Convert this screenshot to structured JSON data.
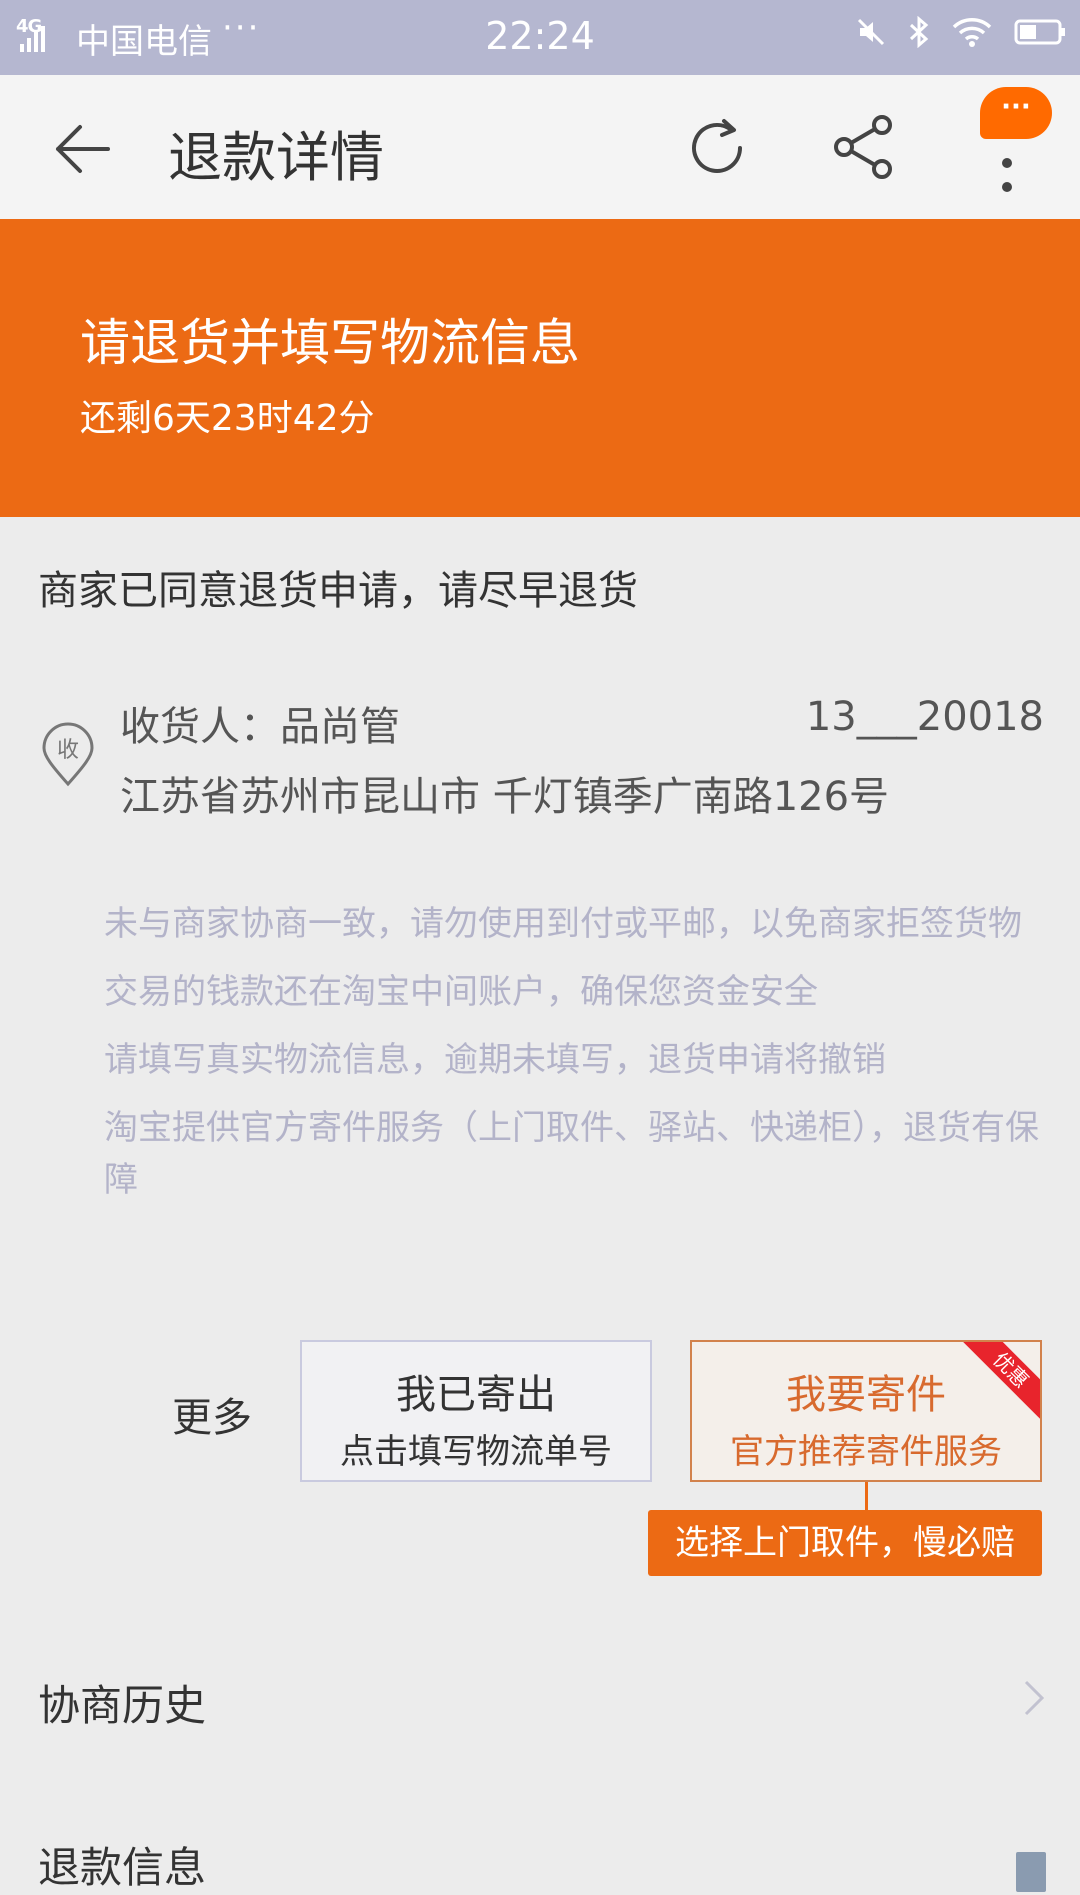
{
  "status_bar": {
    "network": "4G",
    "carrier": "中国电信",
    "more": "···",
    "time": "22:24"
  },
  "nav": {
    "title": "退款详情",
    "message_badge": "···"
  },
  "banner": {
    "title": "请退货并填写物流信息",
    "countdown": "还剩6天23时42分"
  },
  "status_message": "商家已同意退货申请，请尽早退货",
  "receiver": {
    "icon_label": "收",
    "name_label": "收货人：品尚管",
    "phone": "13___20018",
    "address": "江苏省苏州市昆山市 千灯镇季广南路126号"
  },
  "tips": [
    "未与商家协商一致，请勿使用到付或平邮，以免商家拒签货物",
    "交易的钱款还在淘宝中间账户，确保您资金安全",
    "请填写真实物流信息，逾期未填写，退货申请将撤销",
    "淘宝提供官方寄件服务（上门取件、驿站、快递柜），退货有保障"
  ],
  "actions": {
    "more_label": "更多",
    "sent_title": "我已寄出",
    "sent_sub": "点击填写物流单号",
    "ship_title": "我要寄件",
    "ship_sub": "官方推荐寄件服务",
    "promo_tag": "优惠",
    "pickup_tip": "选择上门取件，慢必赔"
  },
  "sections": {
    "history": "协商历史",
    "refund_info": "退款信息"
  },
  "colors": {
    "accent": "#ec6a14",
    "status_bar": "#b5b7d0",
    "background": "#ececec"
  }
}
